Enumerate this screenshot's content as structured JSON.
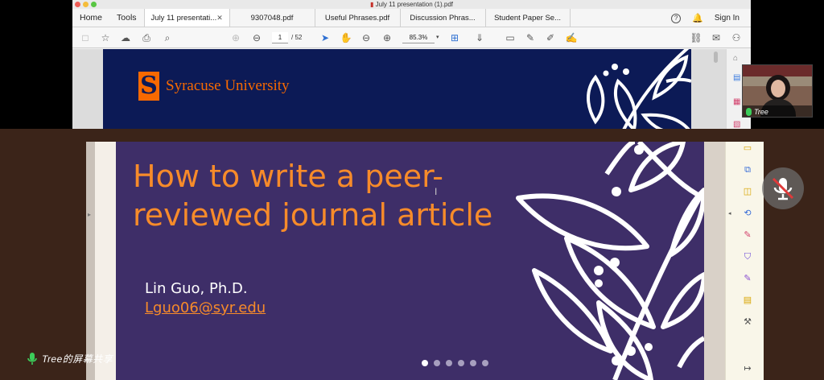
{
  "top_window": {
    "title": "July 11 presentation (1).pdf",
    "tabs": {
      "home": "Home",
      "tools": "Tools",
      "docs": [
        {
          "label": "July 11 presentati...",
          "active": true
        },
        {
          "label": "9307048.pdf"
        },
        {
          "label": "Useful Phrases.pdf"
        },
        {
          "label": "Discussion Phras..."
        },
        {
          "label": "Student Paper Se..."
        }
      ],
      "sign_in": "Sign In"
    },
    "toolbar": {
      "page_current": "1",
      "page_total": "/ 52",
      "zoom": "85.3%"
    },
    "slide_header": {
      "logo_letter": "S",
      "university": "Syracuse University"
    }
  },
  "main_slide": {
    "title": "How to write a peer-reviewed journal article",
    "author": "Lin Guo, Ph.D.",
    "email": "Lguo06@syr.edu",
    "dots_count": 6,
    "active_dot": 0
  },
  "participant": {
    "name": "Tree"
  },
  "screen_share_label": "Tree的屏幕共享",
  "colors": {
    "slide_navy": "#0c1a56",
    "slide_purple": "#3e2e68",
    "orange": "#f78b2a",
    "su_orange": "#f76900",
    "mic_green": "#3ccd5a",
    "mute_red": "#e03a3a"
  }
}
